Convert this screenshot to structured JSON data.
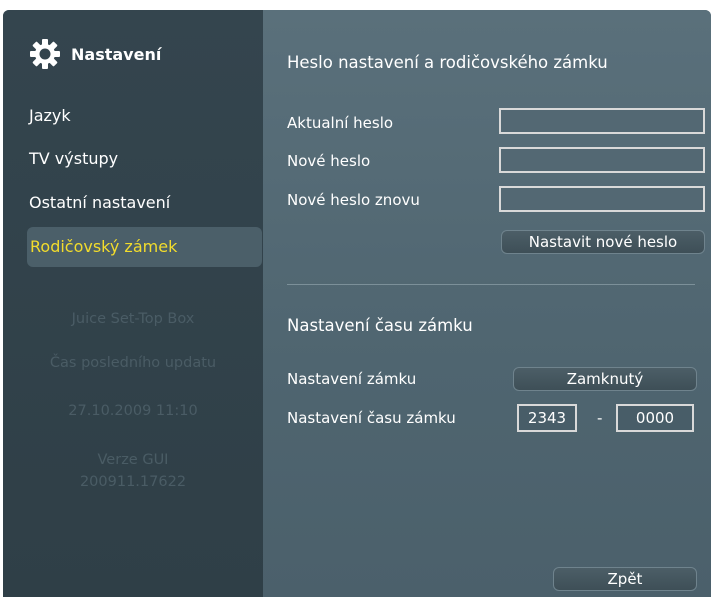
{
  "sidebar": {
    "title": "Nastavení",
    "items": [
      {
        "label": "Jazyk"
      },
      {
        "label": "TV výstupy"
      },
      {
        "label": "Ostatní nastavení"
      },
      {
        "label": "Rodičovský zámek"
      }
    ],
    "active_item": "Rodičovský zámek",
    "info": {
      "product": "Juice Set-Top Box",
      "last_update_label": "Čas posledního updatu",
      "last_update_value": "27.10.2009 11:10",
      "version_label": "Verze GUI",
      "version_value": "200911.17622"
    }
  },
  "password_section": {
    "heading": "Heslo nastavení a rodičovského zámku",
    "current_label": "Aktualní heslo",
    "current_value": "",
    "new_label": "Nové heslo",
    "new_value": "",
    "repeat_label": "Nové heslo znovu",
    "repeat_value": "",
    "set_button": "Nastavit nové heslo"
  },
  "lock_time_section": {
    "heading": "Nastavení času zámku",
    "lock_label": "Nastavení zámku",
    "lock_value": "Zamknutý",
    "time_label": "Nastavení času zámku",
    "time_from": "2343",
    "separator": "-",
    "time_to": "0000"
  },
  "footer": {
    "back_button": "Zpět"
  },
  "colors": {
    "active_text": "#f2dc2c",
    "sidebar_bg": "#33444d",
    "main_bg": "#566b76"
  }
}
